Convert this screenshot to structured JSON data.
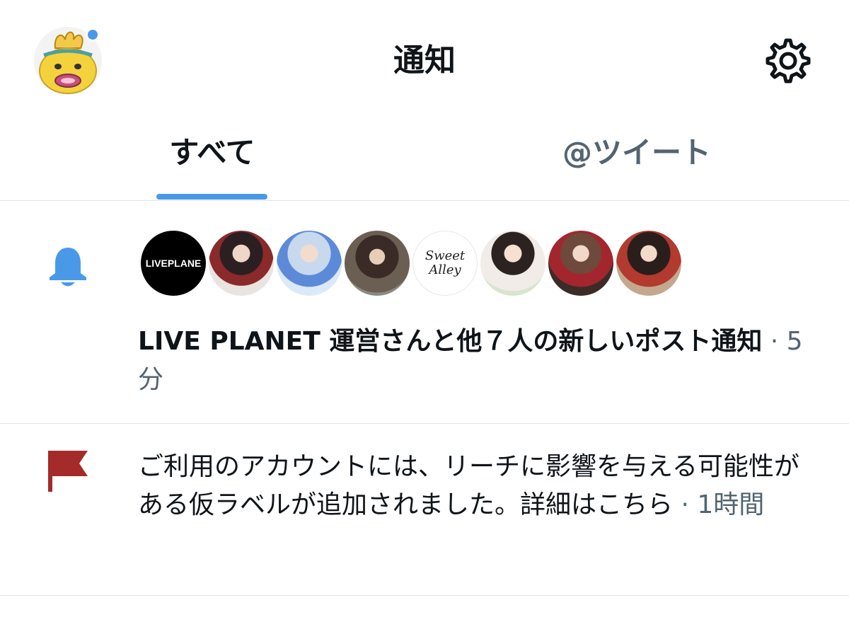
{
  "header": {
    "title": "通知",
    "avatar_icon": "profile-avatar",
    "settings_icon": "gear-icon"
  },
  "tabs": [
    {
      "label": "すべて",
      "active": true
    },
    {
      "label": "@ツイート",
      "active": false
    }
  ],
  "notifications": [
    {
      "icon": "bell-icon",
      "icon_color": "#4a99e9",
      "avatars": [
        {
          "type": "logo",
          "text": "LIVEPLANE"
        },
        {
          "type": "photo"
        },
        {
          "type": "photo"
        },
        {
          "type": "photo"
        },
        {
          "type": "logo",
          "text": "Sweet Alley"
        },
        {
          "type": "photo"
        },
        {
          "type": "photo"
        },
        {
          "type": "photo"
        }
      ],
      "bold_name": "LIVE PLANET 運営",
      "text": "さんと他７人の新しいポスト通知",
      "time": " · 5 分"
    },
    {
      "icon": "flag-icon",
      "icon_color": "#a52a2a",
      "text": "ご利用のアカウントには、リーチに影響を与える可能性がある仮ラベルが追加されました。詳細はこちら",
      "time": " · 1時間"
    }
  ],
  "colors": {
    "accent": "#4a99e9",
    "text": "#0f1419",
    "secondary": "#536471",
    "divider": "#e1e5e8"
  }
}
